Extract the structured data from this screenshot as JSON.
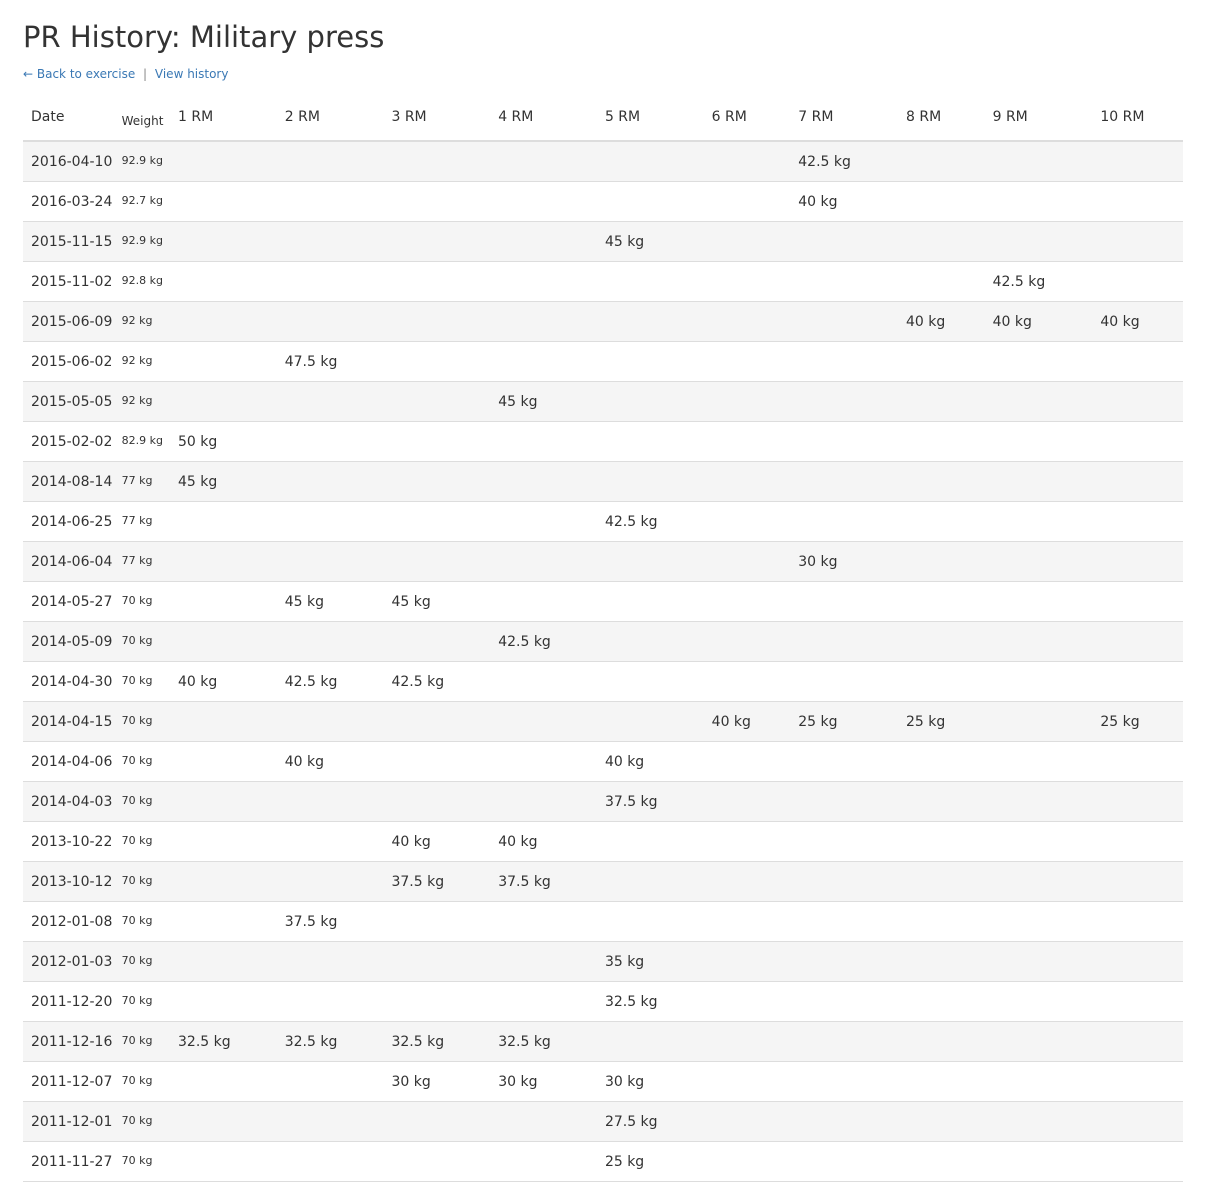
{
  "page": {
    "title": "PR History: Military press",
    "back_link": "← Back to exercise",
    "separator": "|",
    "history_link": "View history"
  },
  "table": {
    "headers": [
      "Date",
      "Weight",
      "1 RM",
      "2 RM",
      "3 RM",
      "4 RM",
      "5 RM",
      "6 RM",
      "7 RM",
      "8 RM",
      "9 RM",
      "10 RM"
    ],
    "rows": [
      [
        "2016-04-10",
        "92.9 kg",
        "",
        "",
        "",
        "",
        "",
        "",
        "42.5 kg",
        "",
        "",
        ""
      ],
      [
        "2016-03-24",
        "92.7 kg",
        "",
        "",
        "",
        "",
        "",
        "",
        "40 kg",
        "",
        "",
        ""
      ],
      [
        "2015-11-15",
        "92.9 kg",
        "",
        "",
        "",
        "",
        "45 kg",
        "",
        "",
        "",
        "",
        ""
      ],
      [
        "2015-11-02",
        "92.8 kg",
        "",
        "",
        "",
        "",
        "",
        "",
        "",
        "",
        "42.5 kg",
        ""
      ],
      [
        "2015-06-09",
        "92 kg",
        "",
        "",
        "",
        "",
        "",
        "",
        "",
        "40 kg",
        "40 kg",
        "40 kg"
      ],
      [
        "2015-06-02",
        "92 kg",
        "",
        "47.5 kg",
        "",
        "",
        "",
        "",
        "",
        "",
        "",
        ""
      ],
      [
        "2015-05-05",
        "92 kg",
        "",
        "",
        "",
        "45 kg",
        "",
        "",
        "",
        "",
        "",
        ""
      ],
      [
        "2015-02-02",
        "82.9 kg",
        "50 kg",
        "",
        "",
        "",
        "",
        "",
        "",
        "",
        "",
        ""
      ],
      [
        "2014-08-14",
        "77 kg",
        "45 kg",
        "",
        "",
        "",
        "",
        "",
        "",
        "",
        "",
        ""
      ],
      [
        "2014-06-25",
        "77 kg",
        "",
        "",
        "",
        "",
        "42.5 kg",
        "",
        "",
        "",
        "",
        ""
      ],
      [
        "2014-06-04",
        "77 kg",
        "",
        "",
        "",
        "",
        "",
        "",
        "30 kg",
        "",
        "",
        ""
      ],
      [
        "2014-05-27",
        "70 kg",
        "",
        "45 kg",
        "45 kg",
        "",
        "",
        "",
        "",
        "",
        "",
        ""
      ],
      [
        "2014-05-09",
        "70 kg",
        "",
        "",
        "",
        "42.5 kg",
        "",
        "",
        "",
        "",
        "",
        ""
      ],
      [
        "2014-04-30",
        "70 kg",
        "40 kg",
        "42.5 kg",
        "42.5 kg",
        "",
        "",
        "",
        "",
        "",
        "",
        ""
      ],
      [
        "2014-04-15",
        "70 kg",
        "",
        "",
        "",
        "",
        "",
        "40 kg",
        "25 kg",
        "25 kg",
        "",
        "25 kg"
      ],
      [
        "2014-04-06",
        "70 kg",
        "",
        "40 kg",
        "",
        "",
        "40 kg",
        "",
        "",
        "",
        "",
        ""
      ],
      [
        "2014-04-03",
        "70 kg",
        "",
        "",
        "",
        "",
        "37.5 kg",
        "",
        "",
        "",
        "",
        ""
      ],
      [
        "2013-10-22",
        "70 kg",
        "",
        "",
        "40 kg",
        "40 kg",
        "",
        "",
        "",
        "",
        "",
        ""
      ],
      [
        "2013-10-12",
        "70 kg",
        "",
        "",
        "37.5 kg",
        "37.5 kg",
        "",
        "",
        "",
        "",
        "",
        ""
      ],
      [
        "2012-01-08",
        "70 kg",
        "",
        "37.5 kg",
        "",
        "",
        "",
        "",
        "",
        "",
        "",
        ""
      ],
      [
        "2012-01-03",
        "70 kg",
        "",
        "",
        "",
        "",
        "35 kg",
        "",
        "",
        "",
        "",
        ""
      ],
      [
        "2011-12-20",
        "70 kg",
        "",
        "",
        "",
        "",
        "32.5 kg",
        "",
        "",
        "",
        "",
        ""
      ],
      [
        "2011-12-16",
        "70 kg",
        "32.5 kg",
        "32.5 kg",
        "32.5 kg",
        "32.5 kg",
        "",
        "",
        "",
        "",
        "",
        ""
      ],
      [
        "2011-12-07",
        "70 kg",
        "",
        "",
        "30 kg",
        "30 kg",
        "30 kg",
        "",
        "",
        "",
        "",
        ""
      ],
      [
        "2011-12-01",
        "70 kg",
        "",
        "",
        "",
        "",
        "27.5 kg",
        "",
        "",
        "",
        "",
        ""
      ],
      [
        "2011-11-27",
        "70 kg",
        "",
        "",
        "",
        "",
        "25 kg",
        "",
        "",
        "",
        "",
        ""
      ]
    ]
  },
  "colors": {
    "link": "#3a78b4",
    "stripe": "#f5f5f5",
    "border": "#dddddd",
    "text": "#333333"
  }
}
